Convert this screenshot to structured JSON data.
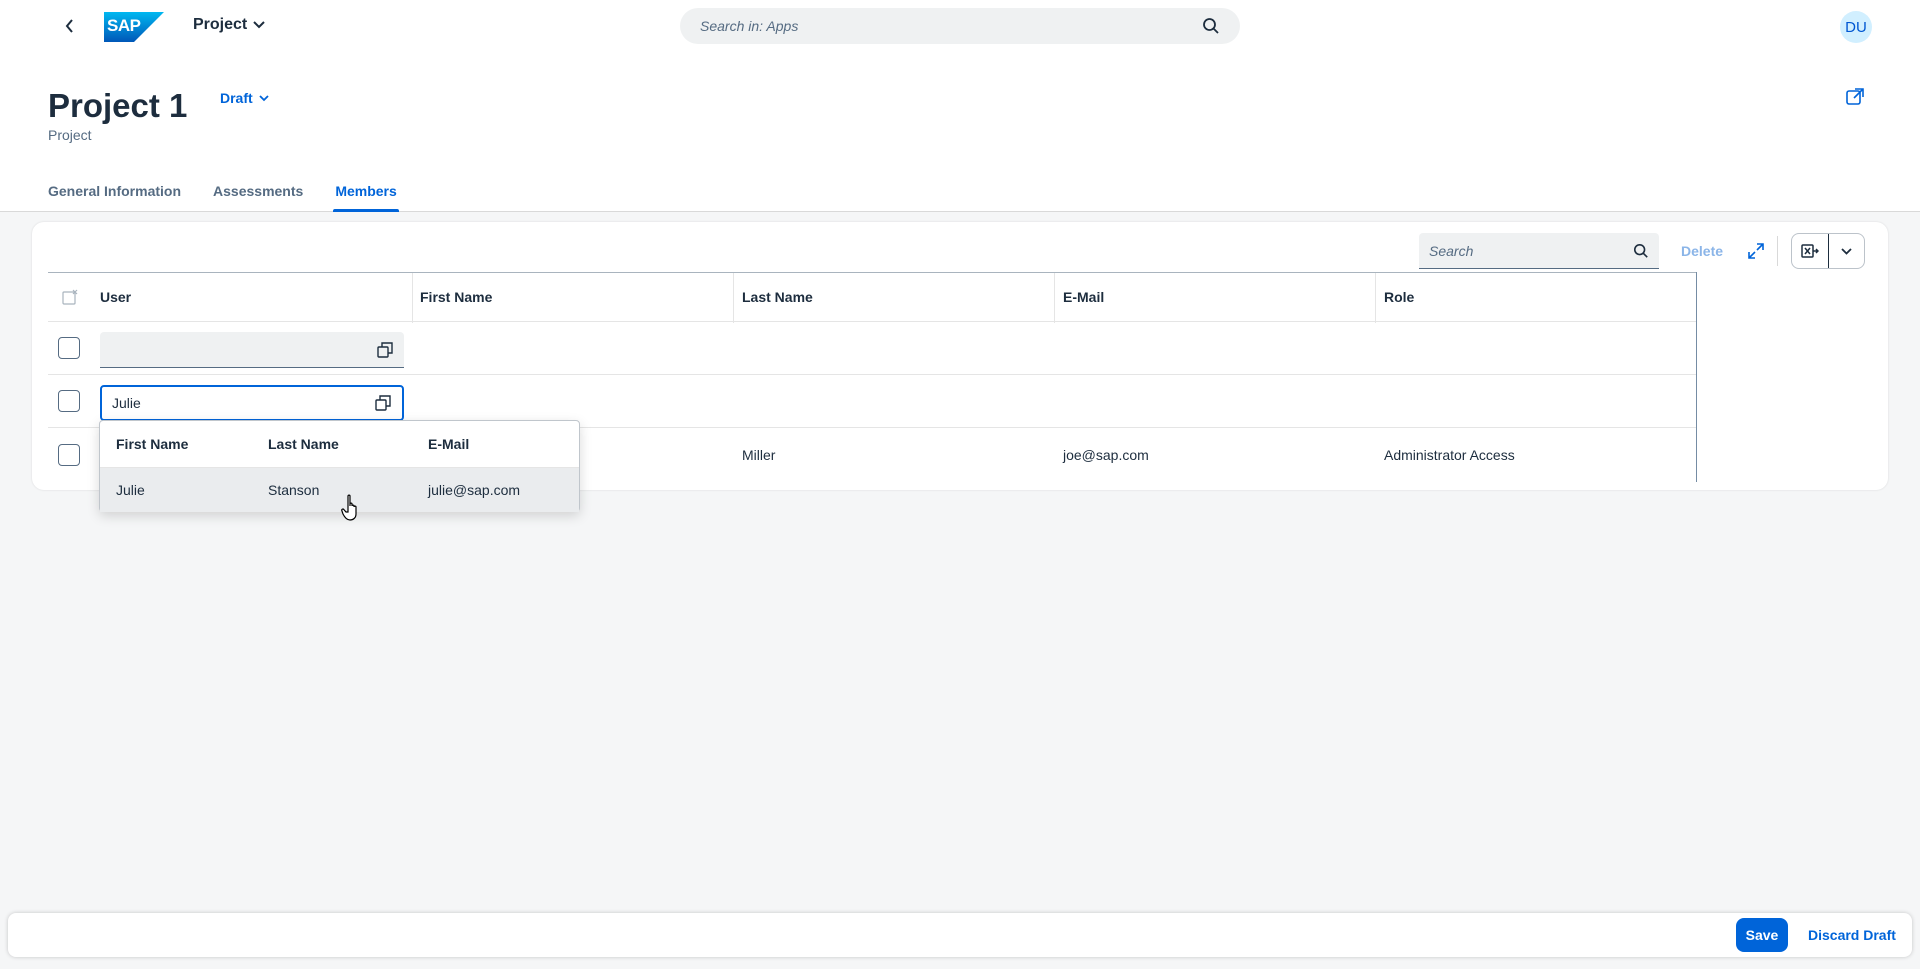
{
  "shell": {
    "app_title": "Project",
    "search_placeholder": "Search in: Apps",
    "avatar_initials": "DU",
    "logo_text": "SAP"
  },
  "header": {
    "title": "Project 1",
    "status": "Draft",
    "subtitle": "Project",
    "tabs": [
      "General Information",
      "Assessments",
      "Members"
    ],
    "active_tab": "Members"
  },
  "members": {
    "toolbar": {
      "search_placeholder": "Search",
      "delete_label": "Delete"
    },
    "columns": [
      "User",
      "First Name",
      "Last Name",
      "E-Mail",
      "Role"
    ],
    "rows": [
      {
        "user": "",
        "first_name": "",
        "last_name": "",
        "email": "",
        "role": ""
      },
      {
        "user": "Julie",
        "first_name": "",
        "last_name": "",
        "email": "",
        "role": ""
      },
      {
        "user": "",
        "first_name": "",
        "last_name": "Miller",
        "email": "joe@sap.com",
        "role": "Administrator Access"
      }
    ],
    "suggestions": {
      "columns": [
        "First Name",
        "Last Name",
        "E-Mail"
      ],
      "items": [
        {
          "first_name": "Julie",
          "last_name": "Stanson",
          "email": "julie@sap.com"
        }
      ]
    }
  },
  "footer": {
    "save_label": "Save",
    "discard_label": "Discard Draft"
  },
  "colors": {
    "accent": "#0064d9",
    "shell_bg": "#ffffff",
    "page_bg": "#f5f6f7",
    "avatar_bg": "#d1efff"
  }
}
